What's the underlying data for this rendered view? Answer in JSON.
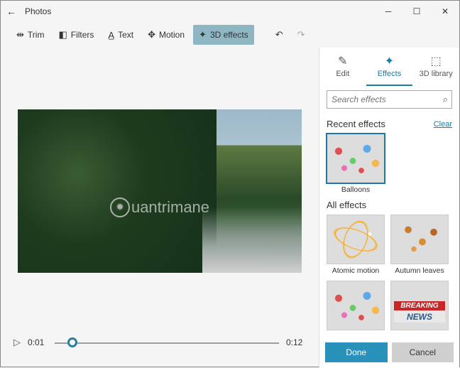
{
  "titlebar": {
    "title": "Photos"
  },
  "toolbar": {
    "trim": "Trim",
    "filters": "Filters",
    "text": "Text",
    "motion": "Motion",
    "effects3d": "3D effects"
  },
  "timeline": {
    "current": "0:01",
    "total": "0:12"
  },
  "panel": {
    "tabs": {
      "edit": "Edit",
      "effects": "Effects",
      "library": "3D library"
    },
    "search_placeholder": "Search effects",
    "recent_title": "Recent effects",
    "clear": "Clear",
    "all_title": "All effects",
    "recent": [
      {
        "name": "Balloons"
      }
    ],
    "all": [
      {
        "name": "Atomic motion"
      },
      {
        "name": "Autumn leaves"
      }
    ],
    "done": "Done",
    "cancel": "Cancel"
  },
  "watermark": "uantrimane"
}
